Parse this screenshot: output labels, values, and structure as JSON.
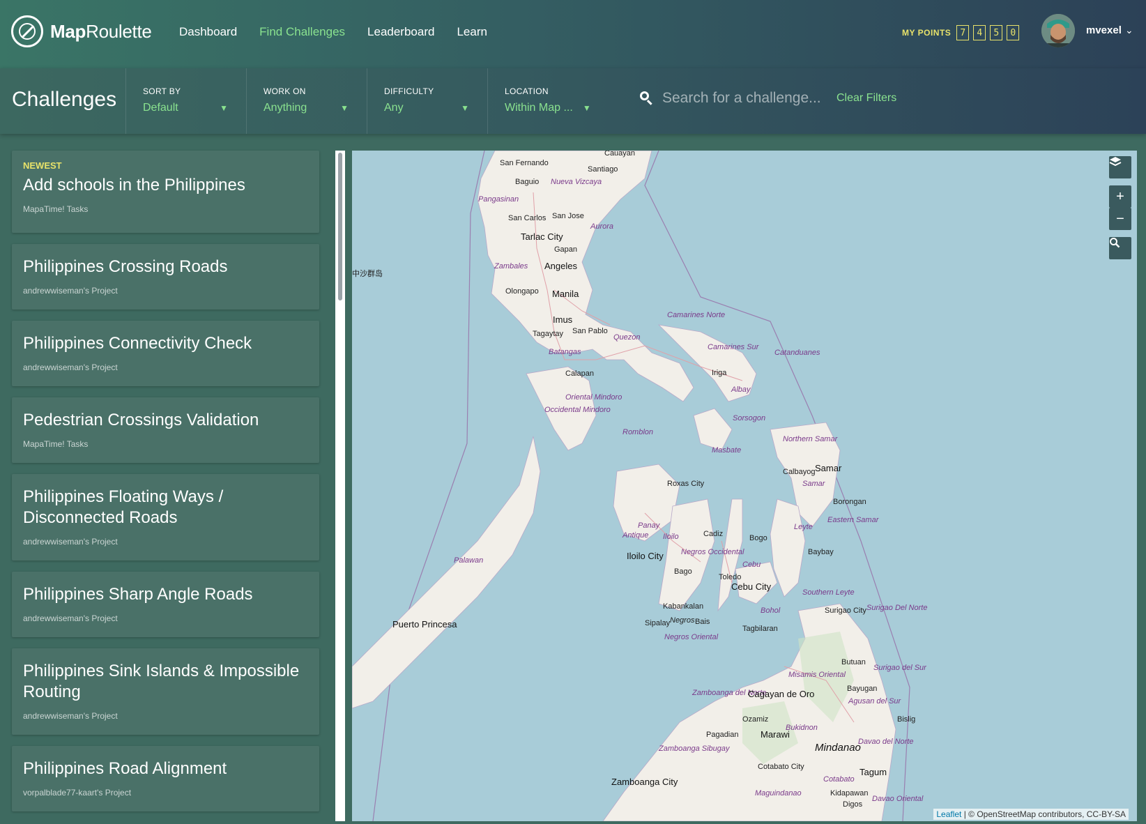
{
  "app": {
    "brand_bold": "Map",
    "brand_rest": "Roulette"
  },
  "nav": {
    "items": [
      "Dashboard",
      "Find Challenges",
      "Leaderboard",
      "Learn"
    ]
  },
  "user": {
    "points_label": "MY POINTS",
    "points_digits": [
      "7",
      "4",
      "5",
      "0"
    ],
    "name": "mvexel"
  },
  "filters": {
    "title": "Challenges",
    "sort": {
      "label": "SORT BY",
      "value": "Default"
    },
    "work": {
      "label": "WORK ON",
      "value": "Anything"
    },
    "difficulty": {
      "label": "DIFFICULTY",
      "value": "Any"
    },
    "location": {
      "label": "LOCATION",
      "value": "Within Map ..."
    },
    "search_placeholder": "Search for a challenge...",
    "clear": "Clear Filters"
  },
  "challenges": [
    {
      "badge": "NEWEST",
      "title": "Add schools in the Philippines",
      "project": "MapaTime! Tasks"
    },
    {
      "title": "Philippines Crossing Roads",
      "project": "andrewwiseman's Project"
    },
    {
      "title": "Philippines Connectivity Check",
      "project": "andrewwiseman's Project"
    },
    {
      "title": "Pedestrian Crossings Validation",
      "project": "MapaTime! Tasks"
    },
    {
      "title": "Philippines Floating Ways / Disconnected Roads",
      "project": "andrewwiseman's Project"
    },
    {
      "title": "Philippines Sharp Angle Roads",
      "project": "andrewwiseman's Project"
    },
    {
      "title": "Philippines Sink Islands & Impossible Routing",
      "project": "andrewwiseman's Project"
    },
    {
      "title": "Philippines Road Alignment",
      "project": "vorpalblade77-kaart's Project"
    }
  ],
  "map": {
    "controls": {
      "zoom_in": "+",
      "zoom_out": "−"
    },
    "attribution_leaflet": "Leaflet",
    "attribution_rest": " | © OpenStreetMap contributors, CC-BY-SA",
    "labels": {
      "cauayan": "Cauayan",
      "san_fernando": "San Fernando",
      "santiago": "Santiago",
      "baguio": "Baguio",
      "nueva_vizcaya": "Nueva Vizcaya",
      "pangasinan": "Pangasinan",
      "san_carlos": "San Carlos",
      "san_jose": "San Jose",
      "aurora": "Aurora",
      "tarlac": "Tarlac City",
      "gapan": "Gapan",
      "zambales": "Zambales",
      "angeles": "Angeles",
      "olongapo": "Olongapo",
      "manila": "Manila",
      "imus": "Imus",
      "tagaytay": "Tagaytay",
      "san_pablo": "San Pablo",
      "quezon": "Quezon",
      "batangas": "Batangas",
      "camarines_norte": "Camarines Norte",
      "camarines_sur": "Camarines Sur",
      "catanduanes": "Catanduanes",
      "iriga": "Iriga",
      "albay": "Albay",
      "calapan": "Calapan",
      "oriental_mindoro": "Oriental Mindoro",
      "occidental_mindoro": "Occidental Mindoro",
      "sorsogon": "Sorsogon",
      "romblon": "Romblon",
      "masbate": "Masbate",
      "northern_samar": "Northern Samar",
      "samar_bold": "Samar",
      "calbayog": "Calbayog",
      "samar": "Samar",
      "borongan": "Borongan",
      "roxas": "Roxas City",
      "panay": "Panay",
      "eastern_samar": "Eastern Samar",
      "leyte": "Leyte",
      "antique": "Antique",
      "iloilo": "Iloilo",
      "cadiz": "Cadiz",
      "bogo": "Bogo",
      "iloilo_city": "Iloilo City",
      "negros_occidental": "Negros Occidental",
      "cebu": "Cebu",
      "baybay": "Baybay",
      "palawan": "Palawan",
      "bago": "Bago",
      "toledo": "Toledo",
      "cebu_city": "Cebu City",
      "southern_leyte": "Southern Leyte",
      "kabankalan": "Kabankalan",
      "bohol": "Bohol",
      "surigao_city": "Surigao City",
      "surigao_del_norte": "Surigao Del Norte",
      "puerto_princesa": "Puerto Princesa",
      "sipalay": "Sipalay",
      "negros": "Negros",
      "bais": "Bais",
      "tagbilaran": "Tagbilaran",
      "negros_oriental": "Negros Oriental",
      "butuan": "Butuan",
      "surigao_del_sur": "Surigao del Sur",
      "misamis_oriental": "Misamis Oriental",
      "zamboanga_del_norte": "Zamboanga del Norte",
      "cagayan": "Cagayan de Oro",
      "bayugan": "Bayugan",
      "agusan_del_sur": "Agusan del Sur",
      "ozamiz": "Ozamiz",
      "bislig": "Bislig",
      "bukidnon": "Bukidnon",
      "pagadian": "Pagadian",
      "marawi": "Marawi",
      "mindanao": "Mindanao",
      "zamboanga_sibugay": "Zamboanga Sibugay",
      "davao_del_norte": "Davao del Norte",
      "cotabato_city": "Cotabato City",
      "tagum": "Tagum",
      "zamboanga_city": "Zamboanga City",
      "cotabato": "Cotabato",
      "maguindanao": "Maguindanao",
      "kidapawan": "Kidapawan",
      "davao_oriental": "Davao Oriental",
      "digos": "Digos",
      "islands": "中沙群岛"
    }
  }
}
